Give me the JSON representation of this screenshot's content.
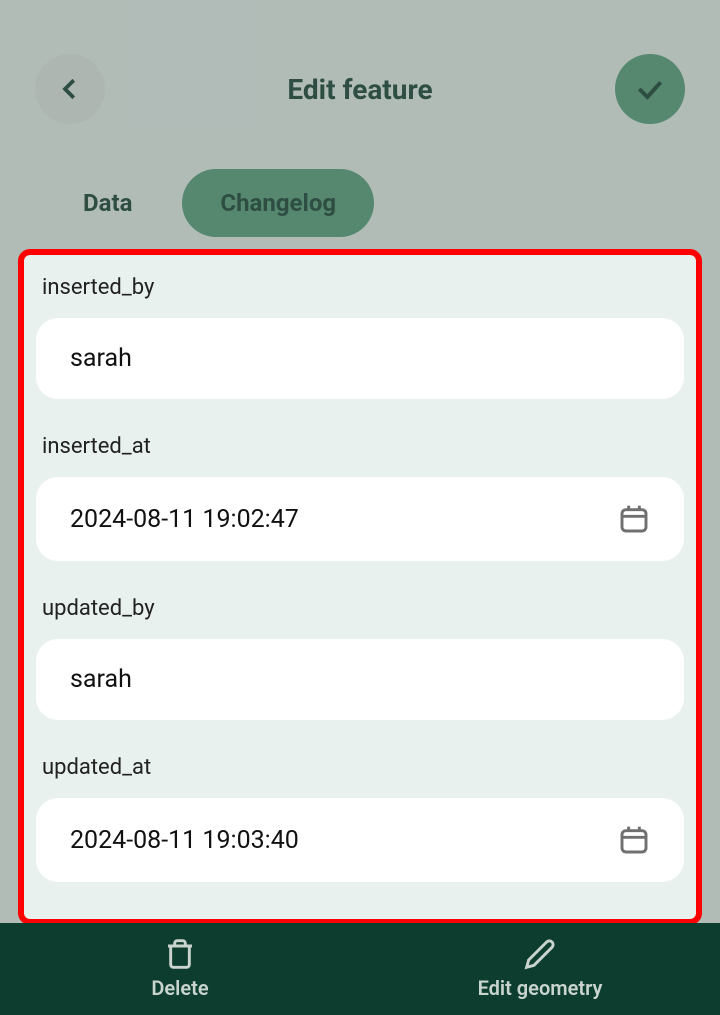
{
  "header": {
    "title": "Edit feature"
  },
  "tabs": {
    "data_label": "Data",
    "changelog_label": "Changelog"
  },
  "fields": {
    "inserted_by": {
      "label": "inserted_by",
      "value": "sarah"
    },
    "inserted_at": {
      "label": "inserted_at",
      "value": "2024-08-11 19:02:47"
    },
    "updated_by": {
      "label": "updated_by",
      "value": "sarah"
    },
    "updated_at": {
      "label": "updated_at",
      "value": "2024-08-11 19:03:40"
    }
  },
  "bottom_bar": {
    "delete_label": "Delete",
    "edit_geometry_label": "Edit geometry"
  }
}
